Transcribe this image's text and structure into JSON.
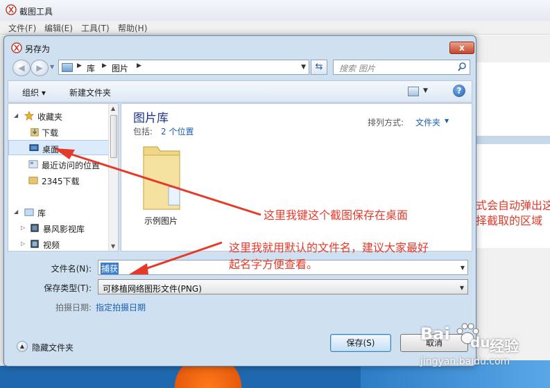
{
  "app": {
    "title": "截图工具",
    "menu": [
      "文件(F)",
      "编辑(E)",
      "工具(T)",
      "帮助(H)"
    ],
    "bg_text": [
      "式会自动弹出这",
      "择截取的区域"
    ]
  },
  "dialog": {
    "title": "另存为",
    "close_label": "x",
    "breadcrumb": [
      "库",
      "图片"
    ],
    "search_placeholder": "搜索 图片",
    "toolbar": {
      "organize": "组织 ▾",
      "new_folder": "新建文件夹",
      "help": "?"
    },
    "nav": {
      "favorites": "收藏夹",
      "downloads": "下载",
      "desktop": "桌面",
      "recent": "最近访问的位置",
      "downloads_2345": "2345下载",
      "libraries": "库",
      "storm_video": "暴风影视库",
      "videos": "视频"
    },
    "content": {
      "library_title": "图片库",
      "includes_label": "包括:",
      "includes_link": "2 个位置",
      "sort_label": "排列方式:",
      "sort_value": "文件夹",
      "folder_name": "示例图片"
    },
    "fields": {
      "filename_label": "文件名(N):",
      "filename_value": "捕获",
      "type_label": "保存类型(T):",
      "type_value": "可移植网络图形文件(PNG)",
      "date_label": "拍摄日期:",
      "date_link": "指定拍摄日期"
    },
    "hide_folders": "隐藏文件夹",
    "save_button": "保存(S)",
    "cancel_button": "取消"
  },
  "annotations": {
    "desktop_note": "这里我键这个截图保存在桌面",
    "filename_note_line1": "这里我就用默认的文件名，建议大家最好",
    "filename_note_line2": "起名字方便查看。",
    "color": "#e53a29"
  },
  "watermark": {
    "logo": "Bai",
    "logo_tail": "du",
    "cn": "经验",
    "url": "jingyan.baidu.com"
  }
}
